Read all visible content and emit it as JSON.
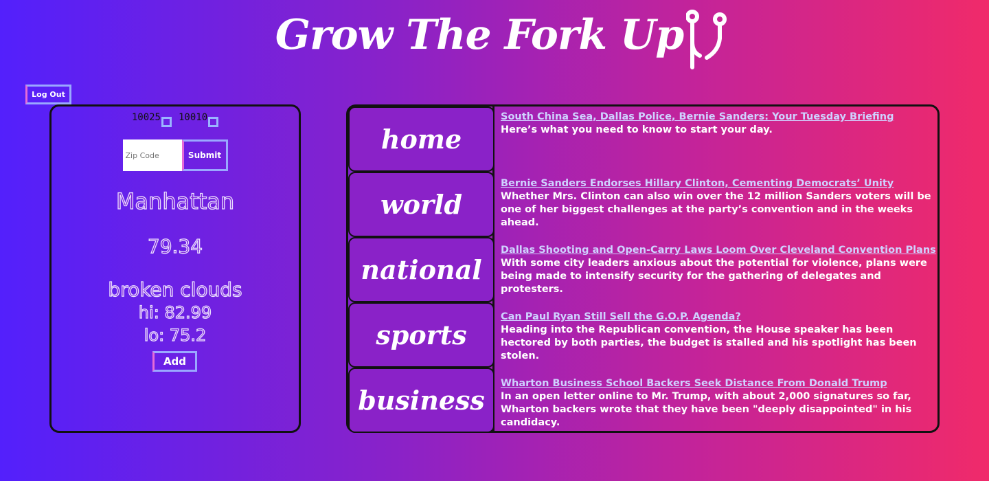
{
  "header": {
    "title": "Grow The Fork Up"
  },
  "logout": {
    "label": "Log Out"
  },
  "weather": {
    "saved_zips": [
      "10025",
      "10010"
    ],
    "zip_placeholder": "Zip Code",
    "submit_label": "Submit",
    "city": "Manhattan",
    "temperature": "79.34",
    "description": "broken clouds",
    "hi": "hi: 82.99",
    "lo": "lo: 75.2",
    "add_label": "Add"
  },
  "news": {
    "tabs": [
      "home",
      "world",
      "national",
      "sports",
      "business"
    ],
    "articles": [
      {
        "headline": "South China Sea, Dallas Police, Bernie Sanders: Your Tuesday Briefing",
        "summary": "Here’s what you need to know to start your day."
      },
      {
        "headline": "Bernie Sanders Endorses Hillary Clinton, Cementing Democrats’ Unity",
        "summary": "Whether Mrs. Clinton can also win over the 12 million Sanders voters will be one of her biggest challenges at the party’s convention and in the weeks ahead."
      },
      {
        "headline": "Dallas Shooting and Open-Carry Laws Loom Over Cleveland Convention Plans",
        "summary": "With some city leaders anxious about the potential for violence, plans were being made to intensify security for the gathering of delegates and protesters."
      },
      {
        "headline": "Can Paul Ryan Still Sell the G.O.P. Agenda?",
        "summary": "Heading into the Republican convention, the House speaker has been hectored by both parties, the budget is stalled and his spotlight has been stolen."
      },
      {
        "headline": "Wharton Business School Backers Seek Distance From Donald Trump",
        "summary": "In an open letter online to Mr. Trump, with about 2,000 signatures so far, Wharton backers wrote that they have been \"deeply disappointed\" in his candidacy."
      }
    ]
  },
  "colors": {
    "gradient_start": "#5320fc",
    "gradient_end": "#f02a6a",
    "link": "#cfd2ff",
    "border": "#111111"
  },
  "icons": [
    "fork-icon"
  ]
}
